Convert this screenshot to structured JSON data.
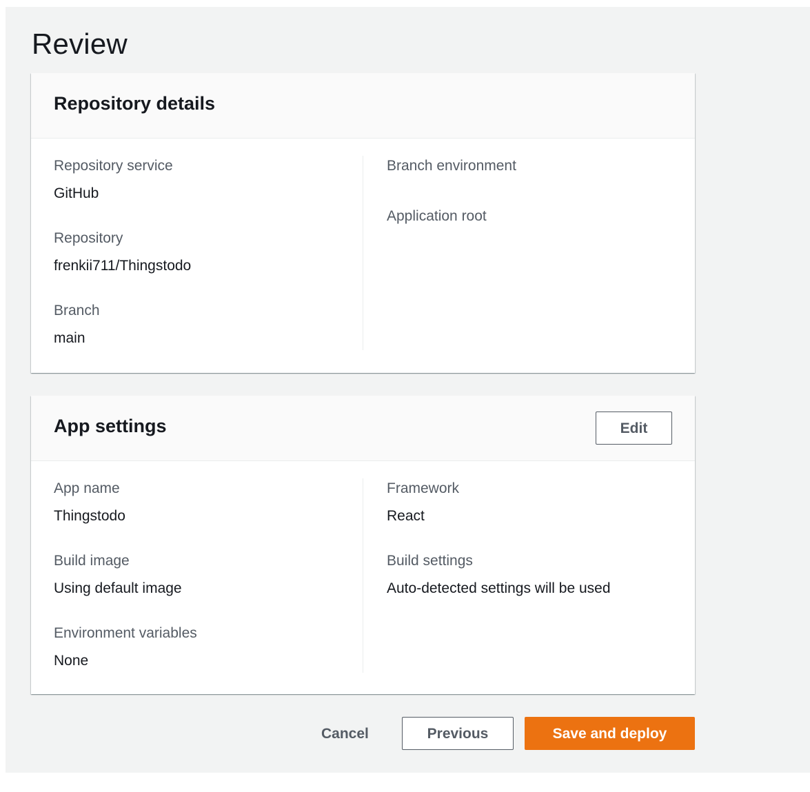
{
  "page": {
    "title": "Review"
  },
  "repository_details": {
    "title": "Repository details",
    "left": [
      {
        "label": "Repository service",
        "value": "GitHub"
      },
      {
        "label": "Repository",
        "value": "frenkii711/Thingstodo"
      },
      {
        "label": "Branch",
        "value": "main"
      }
    ],
    "right": [
      {
        "label": "Branch environment",
        "value": ""
      },
      {
        "label": "Application root",
        "value": ""
      }
    ]
  },
  "app_settings": {
    "title": "App settings",
    "edit_label": "Edit",
    "left": [
      {
        "label": "App name",
        "value": "Thingstodo"
      },
      {
        "label": "Build image",
        "value": "Using default image"
      },
      {
        "label": "Environment variables",
        "value": "None"
      }
    ],
    "right": [
      {
        "label": "Framework",
        "value": "React"
      },
      {
        "label": "Build settings",
        "value": "Auto-detected settings will be used"
      }
    ]
  },
  "actions": {
    "cancel_label": "Cancel",
    "previous_label": "Previous",
    "primary_label": "Save and deploy"
  },
  "colors": {
    "primary": "#ec7211",
    "page_background": "#f2f3f3",
    "text": "#16191f",
    "label_text": "#545b64"
  }
}
